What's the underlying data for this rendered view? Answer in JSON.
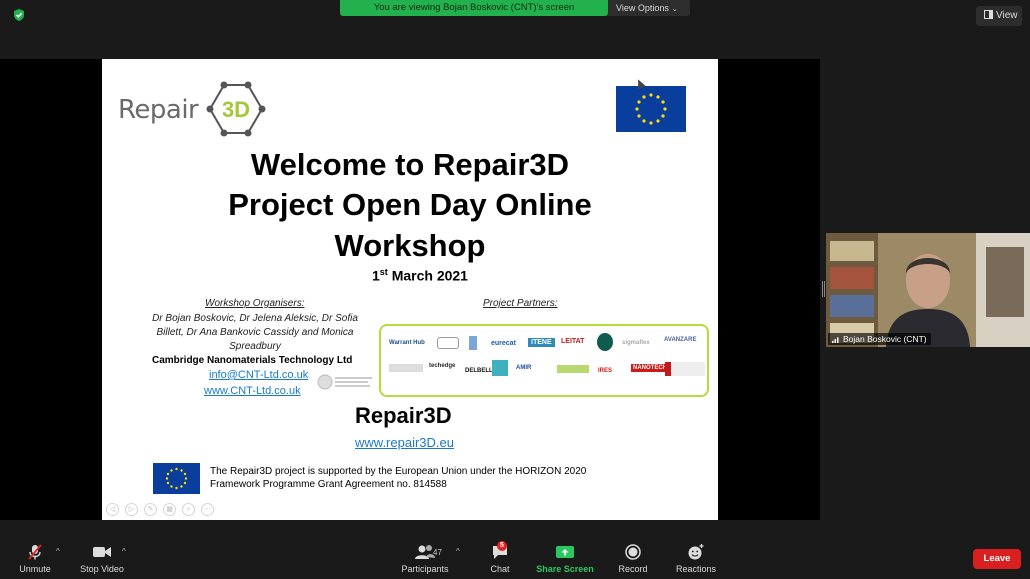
{
  "banner": {
    "text": "You are viewing Bojan Boskovic (CNT)'s screen",
    "view_options": "View Options"
  },
  "top_right": {
    "view_label": "View"
  },
  "slide": {
    "logo_text": "Repair",
    "logo_3d": "3D",
    "title_line1": "Welcome to Repair3D",
    "title_line2": "Project Open Day Online",
    "title_line3": "Workshop",
    "date_day": "1",
    "date_suffix": "st",
    "date_rest": " March 2021",
    "organisers_heading": "Workshop Organisers:",
    "organisers_names": "Dr Bojan Boskovic, Dr Jelena Aleksic, Dr Sofia Billett, Dr Ana Bankovic Cassidy and Monica Spreadbury",
    "organisers_company": "Cambridge Nanomaterials Technology Ltd",
    "organisers_email": "info@CNT-Ltd.co.uk",
    "organisers_web": "www.CNT-Ltd.co.uk",
    "partners_heading": "Project Partners:",
    "partners": [
      "Warrant Hub",
      "eurecat",
      "ITENE",
      "LEITAT",
      "sigmaflex",
      "AVANZARE",
      "techedge",
      "DELBELLO",
      "AMIR",
      "IRES",
      "NANOTECH"
    ],
    "project_name": "Repair3D",
    "project_url": "www.repair3D.eu",
    "footer_line1": "The Repair3D  project is supported by the European Union under the HORIZON 2020",
    "footer_line2": "Framework Programme Grant Agreement no. 814588"
  },
  "video": {
    "participant_name": "Bojan Boskovic (CNT)"
  },
  "toolbar": {
    "unmute": "Unmute",
    "stop_video": "Stop Video",
    "participants": "Participants",
    "participants_count": "47",
    "chat": "Chat",
    "chat_badge": "5",
    "share_screen": "Share Screen",
    "record": "Record",
    "reactions": "Reactions",
    "leave": "Leave"
  },
  "colors": {
    "share_green": "#23b14d",
    "leave_red": "#d91f1f",
    "eu_blue": "#0a3e9c",
    "partner_border": "#b6dc3c",
    "link_blue": "#1a7bc4"
  }
}
